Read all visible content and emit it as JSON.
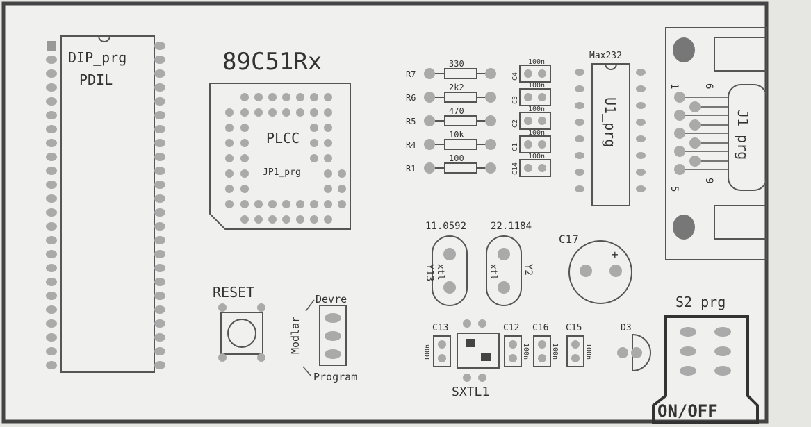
{
  "silkscreen": {
    "dip_label": "DIP_prg",
    "pdil_label": "PDIL",
    "mcu_title": "89C51Rx",
    "plcc_label": "PLCC",
    "jp1_label": "JP1_prg",
    "reset_label": "RESET",
    "devre_label": "Devre",
    "modlar_label": "Modlar",
    "program_label": "Program",
    "max232_label": "Max232",
    "u1_label": "U1_prg",
    "j1_label": "J1_prg",
    "pin1": "1",
    "pin6": "6",
    "pin9": "9",
    "pin5": "5",
    "xtal_freq1": "11.0592",
    "xtal_freq2": "22.1184",
    "xtal_y3": "Y13",
    "xtal_y2": "Y2",
    "xtal_text": "xtl",
    "c17_label": "C17",
    "c17_plus": "+",
    "d3_label": "D3",
    "s2_label": "S2_prg",
    "onoff_label": "ON/OFF",
    "sxtl_label": "SXTL1",
    "c13_label": "C13",
    "c12_label": "C12",
    "c16_label": "C16",
    "c15_label": "C15",
    "val_100n": "100n"
  },
  "resistors": [
    {
      "ref": "R7",
      "value": "330"
    },
    {
      "ref": "R6",
      "value": "2k2"
    },
    {
      "ref": "R5",
      "value": "470"
    },
    {
      "ref": "R4",
      "value": "10k"
    },
    {
      "ref": "R1",
      "value": "100"
    }
  ],
  "caps": [
    {
      "ref": "C4",
      "value": "100n"
    },
    {
      "ref": "C3",
      "value": "100n"
    },
    {
      "ref": "C2",
      "value": "100n"
    },
    {
      "ref": "C1",
      "value": "100n"
    },
    {
      "ref": "C14",
      "value": "100n"
    }
  ]
}
